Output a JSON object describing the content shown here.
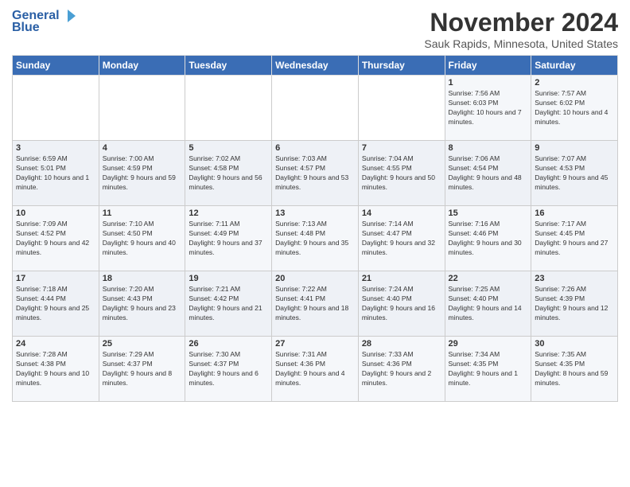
{
  "header": {
    "logo_text_line1": "General",
    "logo_text_line2": "Blue",
    "month_title": "November 2024",
    "location": "Sauk Rapids, Minnesota, United States"
  },
  "weekdays": [
    "Sunday",
    "Monday",
    "Tuesday",
    "Wednesday",
    "Thursday",
    "Friday",
    "Saturday"
  ],
  "weeks": [
    [
      {
        "day": "",
        "sunrise": "",
        "sunset": "",
        "daylight": ""
      },
      {
        "day": "",
        "sunrise": "",
        "sunset": "",
        "daylight": ""
      },
      {
        "day": "",
        "sunrise": "",
        "sunset": "",
        "daylight": ""
      },
      {
        "day": "",
        "sunrise": "",
        "sunset": "",
        "daylight": ""
      },
      {
        "day": "",
        "sunrise": "",
        "sunset": "",
        "daylight": ""
      },
      {
        "day": "1",
        "sunrise": "Sunrise: 7:56 AM",
        "sunset": "Sunset: 6:03 PM",
        "daylight": "Daylight: 10 hours and 7 minutes."
      },
      {
        "day": "2",
        "sunrise": "Sunrise: 7:57 AM",
        "sunset": "Sunset: 6:02 PM",
        "daylight": "Daylight: 10 hours and 4 minutes."
      }
    ],
    [
      {
        "day": "3",
        "sunrise": "Sunrise: 6:59 AM",
        "sunset": "Sunset: 5:01 PM",
        "daylight": "Daylight: 10 hours and 1 minute."
      },
      {
        "day": "4",
        "sunrise": "Sunrise: 7:00 AM",
        "sunset": "Sunset: 4:59 PM",
        "daylight": "Daylight: 9 hours and 59 minutes."
      },
      {
        "day": "5",
        "sunrise": "Sunrise: 7:02 AM",
        "sunset": "Sunset: 4:58 PM",
        "daylight": "Daylight: 9 hours and 56 minutes."
      },
      {
        "day": "6",
        "sunrise": "Sunrise: 7:03 AM",
        "sunset": "Sunset: 4:57 PM",
        "daylight": "Daylight: 9 hours and 53 minutes."
      },
      {
        "day": "7",
        "sunrise": "Sunrise: 7:04 AM",
        "sunset": "Sunset: 4:55 PM",
        "daylight": "Daylight: 9 hours and 50 minutes."
      },
      {
        "day": "8",
        "sunrise": "Sunrise: 7:06 AM",
        "sunset": "Sunset: 4:54 PM",
        "daylight": "Daylight: 9 hours and 48 minutes."
      },
      {
        "day": "9",
        "sunrise": "Sunrise: 7:07 AM",
        "sunset": "Sunset: 4:53 PM",
        "daylight": "Daylight: 9 hours and 45 minutes."
      }
    ],
    [
      {
        "day": "10",
        "sunrise": "Sunrise: 7:09 AM",
        "sunset": "Sunset: 4:52 PM",
        "daylight": "Daylight: 9 hours and 42 minutes."
      },
      {
        "day": "11",
        "sunrise": "Sunrise: 7:10 AM",
        "sunset": "Sunset: 4:50 PM",
        "daylight": "Daylight: 9 hours and 40 minutes."
      },
      {
        "day": "12",
        "sunrise": "Sunrise: 7:11 AM",
        "sunset": "Sunset: 4:49 PM",
        "daylight": "Daylight: 9 hours and 37 minutes."
      },
      {
        "day": "13",
        "sunrise": "Sunrise: 7:13 AM",
        "sunset": "Sunset: 4:48 PM",
        "daylight": "Daylight: 9 hours and 35 minutes."
      },
      {
        "day": "14",
        "sunrise": "Sunrise: 7:14 AM",
        "sunset": "Sunset: 4:47 PM",
        "daylight": "Daylight: 9 hours and 32 minutes."
      },
      {
        "day": "15",
        "sunrise": "Sunrise: 7:16 AM",
        "sunset": "Sunset: 4:46 PM",
        "daylight": "Daylight: 9 hours and 30 minutes."
      },
      {
        "day": "16",
        "sunrise": "Sunrise: 7:17 AM",
        "sunset": "Sunset: 4:45 PM",
        "daylight": "Daylight: 9 hours and 27 minutes."
      }
    ],
    [
      {
        "day": "17",
        "sunrise": "Sunrise: 7:18 AM",
        "sunset": "Sunset: 4:44 PM",
        "daylight": "Daylight: 9 hours and 25 minutes."
      },
      {
        "day": "18",
        "sunrise": "Sunrise: 7:20 AM",
        "sunset": "Sunset: 4:43 PM",
        "daylight": "Daylight: 9 hours and 23 minutes."
      },
      {
        "day": "19",
        "sunrise": "Sunrise: 7:21 AM",
        "sunset": "Sunset: 4:42 PM",
        "daylight": "Daylight: 9 hours and 21 minutes."
      },
      {
        "day": "20",
        "sunrise": "Sunrise: 7:22 AM",
        "sunset": "Sunset: 4:41 PM",
        "daylight": "Daylight: 9 hours and 18 minutes."
      },
      {
        "day": "21",
        "sunrise": "Sunrise: 7:24 AM",
        "sunset": "Sunset: 4:40 PM",
        "daylight": "Daylight: 9 hours and 16 minutes."
      },
      {
        "day": "22",
        "sunrise": "Sunrise: 7:25 AM",
        "sunset": "Sunset: 4:40 PM",
        "daylight": "Daylight: 9 hours and 14 minutes."
      },
      {
        "day": "23",
        "sunrise": "Sunrise: 7:26 AM",
        "sunset": "Sunset: 4:39 PM",
        "daylight": "Daylight: 9 hours and 12 minutes."
      }
    ],
    [
      {
        "day": "24",
        "sunrise": "Sunrise: 7:28 AM",
        "sunset": "Sunset: 4:38 PM",
        "daylight": "Daylight: 9 hours and 10 minutes."
      },
      {
        "day": "25",
        "sunrise": "Sunrise: 7:29 AM",
        "sunset": "Sunset: 4:37 PM",
        "daylight": "Daylight: 9 hours and 8 minutes."
      },
      {
        "day": "26",
        "sunrise": "Sunrise: 7:30 AM",
        "sunset": "Sunset: 4:37 PM",
        "daylight": "Daylight: 9 hours and 6 minutes."
      },
      {
        "day": "27",
        "sunrise": "Sunrise: 7:31 AM",
        "sunset": "Sunset: 4:36 PM",
        "daylight": "Daylight: 9 hours and 4 minutes."
      },
      {
        "day": "28",
        "sunrise": "Sunrise: 7:33 AM",
        "sunset": "Sunset: 4:36 PM",
        "daylight": "Daylight: 9 hours and 2 minutes."
      },
      {
        "day": "29",
        "sunrise": "Sunrise: 7:34 AM",
        "sunset": "Sunset: 4:35 PM",
        "daylight": "Daylight: 9 hours and 1 minute."
      },
      {
        "day": "30",
        "sunrise": "Sunrise: 7:35 AM",
        "sunset": "Sunset: 4:35 PM",
        "daylight": "Daylight: 8 hours and 59 minutes."
      }
    ]
  ]
}
